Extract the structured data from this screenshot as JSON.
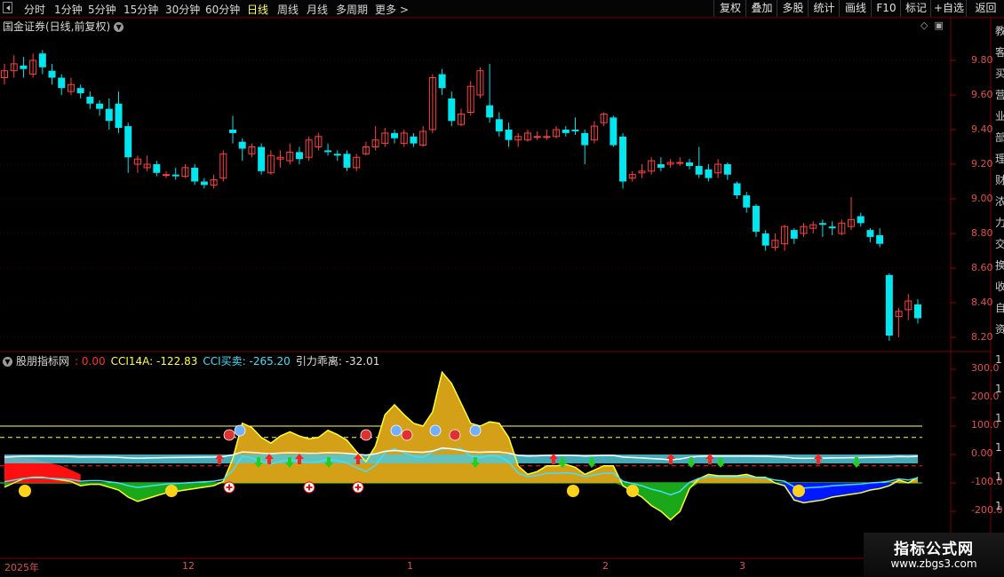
{
  "toolbar": {
    "periods": [
      "分时",
      "1分钟",
      "5分钟",
      "15分钟",
      "30分钟",
      "60分钟",
      "日线",
      "周线",
      "月线",
      "多周期",
      "更多 >"
    ],
    "active_period": "日线",
    "right_buttons": [
      "复权",
      "叠加",
      "多股",
      "统计",
      "画线",
      "F10",
      "标记",
      "+自选",
      "返回"
    ]
  },
  "main_chart": {
    "title": "国金证券(日线,前复权)",
    "price_labels": [
      "9.80",
      "9.60",
      "9.40",
      "9.20",
      "9.00",
      "8.80",
      "8.60",
      "8.40",
      "8.20"
    ],
    "icons": [
      "diamond-icon",
      "window-icon"
    ]
  },
  "indicator": {
    "name": "股朋指标网",
    "values": [
      {
        "label": ": 0.00",
        "color": "#ff3030"
      },
      {
        "label": "CCI14A: -122.83",
        "color": "#ffff40"
      },
      {
        "label": "CCI买卖: -265.20",
        "color": "#40e0ff"
      },
      {
        "label": "引力乖离: -32.01",
        "color": "#e0e0e0"
      }
    ],
    "axis_labels": [
      "300.0",
      "200.0",
      "100.0",
      "0.00",
      "-100.0",
      "-200.0"
    ]
  },
  "dates": [
    "2025年",
    "12",
    "1",
    "2",
    "3"
  ],
  "side_text": [
    "教",
    "客",
    "买",
    "营",
    "业",
    "部",
    "理",
    "财",
    "浓",
    "力",
    "交",
    "换",
    "收",
    "自",
    "资",
    "1",
    "1",
    "1",
    "1",
    "1",
    "1"
  ],
  "watermark": {
    "line1": "指标公式网",
    "line2": "www.zbgs3.com"
  },
  "colors": {
    "up": "#ff4040",
    "down": "#00e5ee",
    "gold": "#d4a017",
    "green": "#1aa81a",
    "blue": "#0018ff"
  },
  "chart_data": {
    "type": "candlestick",
    "ylim": [
      8.15,
      9.95
    ],
    "candles": [
      [
        9.7,
        9.74,
        9.66,
        9.78
      ],
      [
        9.74,
        9.78,
        9.7,
        9.83
      ],
      [
        9.77,
        9.75,
        9.7,
        9.82
      ],
      [
        9.72,
        9.8,
        9.7,
        9.84
      ],
      [
        9.84,
        9.76,
        9.72,
        9.86
      ],
      [
        9.74,
        9.7,
        9.66,
        9.78
      ],
      [
        9.7,
        9.64,
        9.6,
        9.72
      ],
      [
        9.62,
        9.66,
        9.6,
        9.7
      ],
      [
        9.64,
        9.61,
        9.58,
        9.66
      ],
      [
        9.59,
        9.55,
        9.52,
        9.62
      ],
      [
        9.55,
        9.52,
        9.48,
        9.57
      ],
      [
        9.52,
        9.45,
        9.4,
        9.58
      ],
      [
        9.55,
        9.41,
        9.38,
        9.62
      ],
      [
        9.42,
        9.24,
        9.15,
        9.44
      ],
      [
        9.2,
        9.23,
        9.15,
        9.25
      ],
      [
        9.18,
        9.2,
        9.16,
        9.25
      ],
      [
        9.2,
        9.15,
        9.13,
        9.22
      ],
      [
        9.14,
        9.14,
        9.12,
        9.16
      ],
      [
        9.14,
        9.13,
        9.11,
        9.18
      ],
      [
        9.13,
        9.18,
        9.12,
        9.2
      ],
      [
        9.18,
        9.1,
        9.08,
        9.2
      ],
      [
        9.1,
        9.08,
        9.06,
        9.12
      ],
      [
        9.08,
        9.11,
        9.06,
        9.14
      ],
      [
        9.12,
        9.26,
        9.1,
        9.28
      ],
      [
        9.4,
        9.38,
        9.32,
        9.48
      ],
      [
        9.33,
        9.29,
        9.22,
        9.35
      ],
      [
        9.26,
        9.3,
        9.24,
        9.32
      ],
      [
        9.3,
        9.16,
        9.14,
        9.32
      ],
      [
        9.15,
        9.25,
        9.14,
        9.28
      ],
      [
        9.23,
        9.24,
        9.18,
        9.28
      ],
      [
        9.22,
        9.27,
        9.2,
        9.32
      ],
      [
        9.27,
        9.23,
        9.2,
        9.3
      ],
      [
        9.24,
        9.34,
        9.22,
        9.36
      ],
      [
        9.3,
        9.36,
        9.28,
        9.38
      ],
      [
        9.28,
        9.27,
        9.25,
        9.32
      ],
      [
        9.26,
        9.25,
        9.22,
        9.28
      ],
      [
        9.26,
        9.18,
        9.16,
        9.28
      ],
      [
        9.18,
        9.24,
        9.16,
        9.26
      ],
      [
        9.26,
        9.3,
        9.25,
        9.33
      ],
      [
        9.3,
        9.34,
        9.28,
        9.42
      ],
      [
        9.32,
        9.38,
        9.3,
        9.41
      ],
      [
        9.38,
        9.35,
        9.32,
        9.4
      ],
      [
        9.32,
        9.38,
        9.3,
        9.4
      ],
      [
        9.36,
        9.32,
        9.3,
        9.38
      ],
      [
        9.31,
        9.39,
        9.3,
        9.42
      ],
      [
        9.4,
        9.7,
        9.38,
        9.72
      ],
      [
        9.72,
        9.64,
        9.6,
        9.75
      ],
      [
        9.58,
        9.45,
        9.42,
        9.62
      ],
      [
        9.43,
        9.49,
        9.42,
        9.52
      ],
      [
        9.5,
        9.65,
        9.48,
        9.68
      ],
      [
        9.6,
        9.74,
        9.58,
        9.76
      ],
      [
        9.54,
        9.47,
        9.44,
        9.78
      ],
      [
        9.46,
        9.39,
        9.36,
        9.5
      ],
      [
        9.4,
        9.34,
        9.3,
        9.44
      ],
      [
        9.34,
        9.36,
        9.3,
        9.38
      ],
      [
        9.34,
        9.38,
        9.33,
        9.4
      ],
      [
        9.36,
        9.36,
        9.34,
        9.39
      ],
      [
        9.36,
        9.36,
        9.34,
        9.4
      ],
      [
        9.36,
        9.4,
        9.35,
        9.42
      ],
      [
        9.4,
        9.38,
        9.36,
        9.42
      ],
      [
        9.4,
        9.39,
        9.37,
        9.47
      ],
      [
        9.38,
        9.31,
        9.2,
        9.4
      ],
      [
        9.34,
        9.42,
        9.32,
        9.45
      ],
      [
        9.44,
        9.49,
        9.42,
        9.5
      ],
      [
        9.47,
        9.31,
        9.3,
        9.48
      ],
      [
        9.36,
        9.1,
        9.06,
        9.38
      ],
      [
        9.12,
        9.14,
        9.1,
        9.16
      ],
      [
        9.15,
        9.16,
        9.12,
        9.2
      ],
      [
        9.16,
        9.22,
        9.14,
        9.24
      ],
      [
        9.2,
        9.18,
        9.16,
        9.24
      ],
      [
        9.2,
        9.21,
        9.18,
        9.23
      ],
      [
        9.21,
        9.21,
        9.19,
        9.24
      ],
      [
        9.21,
        9.19,
        9.17,
        9.23
      ],
      [
        9.19,
        9.14,
        9.12,
        9.3
      ],
      [
        9.17,
        9.12,
        9.1,
        9.2
      ],
      [
        9.15,
        9.2,
        9.12,
        9.23
      ],
      [
        9.2,
        9.14,
        9.11,
        9.21
      ],
      [
        9.09,
        9.02,
        9.0,
        9.1
      ],
      [
        9.02,
        8.95,
        8.92,
        9.04
      ],
      [
        8.96,
        8.81,
        8.78,
        8.97
      ],
      [
        8.8,
        8.73,
        8.7,
        8.82
      ],
      [
        8.72,
        8.76,
        8.7,
        8.8
      ],
      [
        8.74,
        8.84,
        8.7,
        8.85
      ],
      [
        8.82,
        8.77,
        8.74,
        8.83
      ],
      [
        8.8,
        8.84,
        8.78,
        8.86
      ],
      [
        8.83,
        8.85,
        8.8,
        8.87
      ],
      [
        8.86,
        8.85,
        8.78,
        8.88
      ],
      [
        8.84,
        8.83,
        8.79,
        8.87
      ],
      [
        8.8,
        8.86,
        8.79,
        8.88
      ],
      [
        8.84,
        8.88,
        8.82,
        9.01
      ],
      [
        8.9,
        8.86,
        8.84,
        8.92
      ],
      [
        8.82,
        8.78,
        8.75,
        8.83
      ],
      [
        8.79,
        8.74,
        8.72,
        8.83
      ],
      [
        8.56,
        8.21,
        8.18,
        8.57
      ],
      [
        8.32,
        8.35,
        8.2,
        8.37
      ],
      [
        8.36,
        8.41,
        8.3,
        8.45
      ],
      [
        8.39,
        8.31,
        8.28,
        8.42
      ]
    ]
  }
}
